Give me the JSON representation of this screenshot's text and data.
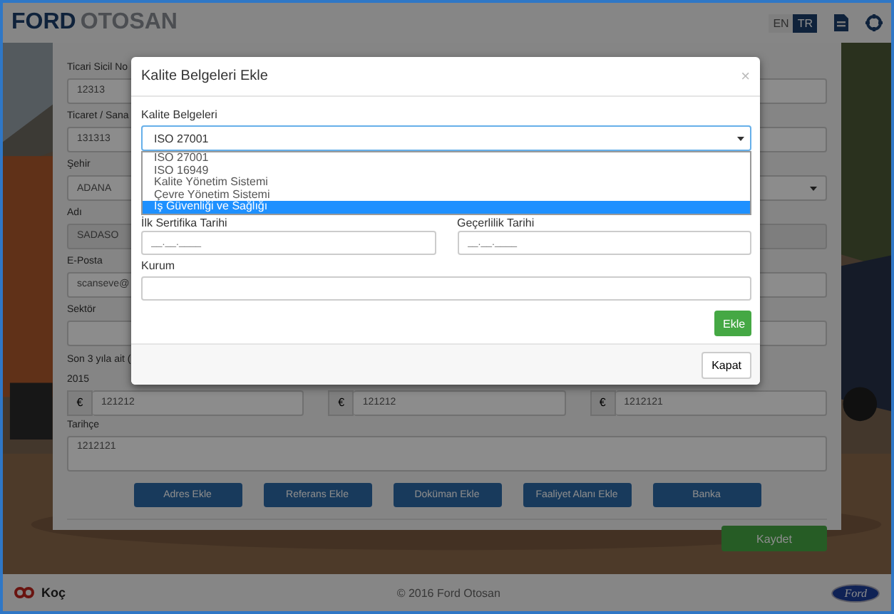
{
  "header": {
    "logo_bold": "FORD",
    "logo_light": "OTOSAN",
    "languages": [
      {
        "label": "EN",
        "selected": false
      },
      {
        "label": "TR",
        "selected": true
      }
    ]
  },
  "form": {
    "rows": [
      {
        "fields": [
          {
            "label": "Ticari Sicil No",
            "value": "12313",
            "kind": "text"
          },
          {
            "kind": "text"
          }
        ]
      },
      {
        "fields": [
          {
            "label": "Ticaret / Sana",
            "value": "131313",
            "kind": "text"
          },
          {
            "kind": "text"
          }
        ]
      },
      {
        "fields": [
          {
            "label": "Şehir",
            "value": "ADANA",
            "kind": "select"
          }
        ]
      },
      {
        "fields": [
          {
            "label": "Adı",
            "value": "SADASO",
            "kind": "text"
          },
          {
            "kind": "text"
          }
        ]
      },
      {
        "fields": [
          {
            "label": "E-Posta",
            "value": "scanseve@",
            "kind": "text"
          },
          {
            "kind": "text"
          }
        ]
      },
      {
        "fields": [
          {
            "label": "Sektör",
            "kind": "text"
          },
          {
            "kind": "text"
          }
        ]
      }
    ],
    "years_heading": "Son 3 yıla ait (",
    "years": [
      {
        "label": "2015",
        "currency": "€",
        "value": "121212"
      },
      {
        "currency": "€",
        "value": "121212"
      },
      {
        "currency": "€",
        "value": "1212121"
      }
    ],
    "history": {
      "label": "Tarihçe",
      "value": "1212121"
    },
    "buttons": [
      "Adres Ekle",
      "Referans Ekle",
      "Doküman Ekle",
      "Faaliyet Alanı Ekle",
      "Banka"
    ],
    "save": "Kaydet"
  },
  "footer": {
    "brand": "Koç",
    "copyright": "© 2016 Ford Otosan",
    "badge": "Ford"
  },
  "modal": {
    "title": "Kalite Belgeleri Ekle",
    "close": "×",
    "select_label": "Kalite Belgeleri",
    "select_value": "ISO 27001",
    "options": [
      {
        "label": "ISO 27001",
        "selected": false
      },
      {
        "label": "ISO 16949",
        "selected": false
      },
      {
        "label": "Kalite Yönetim Sistemi",
        "selected": false
      },
      {
        "label": "Çevre Yönetim Sistemi",
        "selected": false
      },
      {
        "label": "İş Güvenliği ve Sağlığı",
        "selected": true
      }
    ],
    "dates": [
      {
        "label": "İlk Sertifika Tarihi",
        "placeholder": "__.__.____"
      },
      {
        "label": "Geçerlilik Tarihi",
        "placeholder": "__.__.____"
      }
    ],
    "org_label": "Kurum",
    "add": "Ekle",
    "dismiss": "Kapat"
  }
}
